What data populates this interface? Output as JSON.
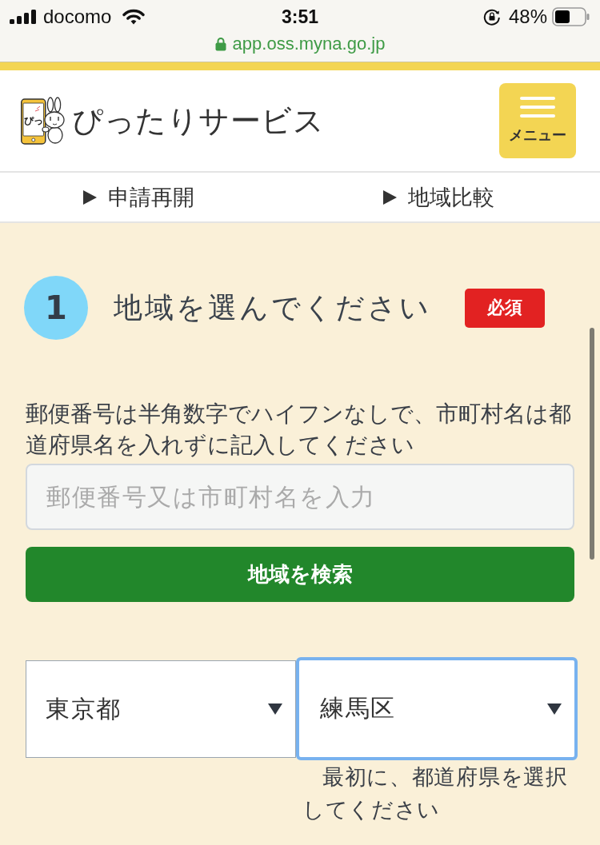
{
  "status_bar": {
    "carrier": "docomo",
    "time": "3:51",
    "battery": "48%"
  },
  "address_bar": {
    "url": "app.oss.myna.go.jp"
  },
  "header": {
    "logo_text": "ぴっ",
    "title": "ぴったりサービス",
    "menu_button": "メニュー"
  },
  "nav_links": [
    "申請再開",
    "地域比較"
  ],
  "step": {
    "number": "1",
    "title": "地域を選んでください",
    "badge": "必須"
  },
  "instructions": "郵便番号は半角数字でハイフンなしで、市町村名は都道府県名を入れずに記入してください",
  "search": {
    "placeholder": "郵便番号又は市町村名を入力",
    "button": "地域を検索"
  },
  "selects": [
    {
      "value": "東京都",
      "focused": false
    },
    {
      "value": "練馬区",
      "focused": true
    }
  ],
  "select_hint": "最初に、都道府県を選択してください"
}
